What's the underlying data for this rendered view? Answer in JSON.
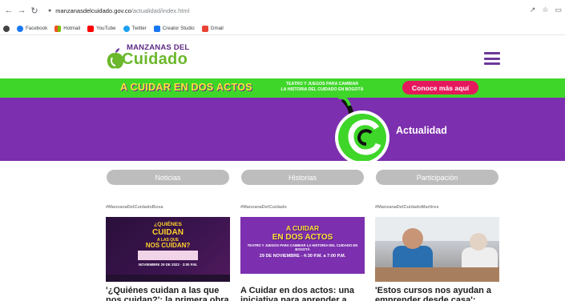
{
  "browser": {
    "url_host": "manzanasdelcuidado.gov.co",
    "url_path": "/actualidad/index.html",
    "bookmarks": [
      "Facebook",
      "Hotmail",
      "YouTube",
      "Twitter",
      "Creator Studio",
      "Gmail"
    ]
  },
  "header": {
    "logo_top": "MANZANAS DEL",
    "logo_main": "Cuidado"
  },
  "banner": {
    "title": "A CUIDAR EN DOS ACTOS",
    "subtitle_line1": "TEATRO Y JUEGOS PARA CAMBIAR",
    "subtitle_line2": "LA HISTORIA DEL CUIDADO EN BOGOTÁ",
    "cta": "Conoce más aquí",
    "colors": {
      "background": "#3fd62a",
      "cta": "#e6185d",
      "title": "#ffe43a"
    }
  },
  "hero": {
    "title": "Actualidad",
    "color": "#7c2fae"
  },
  "tabs": [
    "Noticias",
    "Historias",
    "Participación"
  ],
  "cards": [
    {
      "tag": "#ManzanaDelCuidadoBosa",
      "image_text": [
        "¿QUIÉNES",
        "CUIDAN",
        "A LAS QUE",
        "NOS CUIDAN?",
        "NOVIEMBRE 29 DE 2022 · 3:00 P.M."
      ],
      "title": "'¿Quiénes cuidan a las que nos cuidan?': la primera obra"
    },
    {
      "tag": "#ManzanaDelCuidado",
      "image_text": [
        "A CUIDAR",
        "EN DOS ACTOS",
        "TEATRO Y JUEGOS PARA CAMBIAR LA HISTORIA DEL CUIDADO EN BOGOTÁ",
        "29 DE NOVIEMBRE - 4:30 P.M. a 7:00 P.M."
      ],
      "title": "A Cuidar en dos actos: una iniciativa para aprender a"
    },
    {
      "tag": "#ManzanaDelCuidadoMartires",
      "title": "'Estos cursos nos ayudan a emprender desde casa':"
    }
  ]
}
